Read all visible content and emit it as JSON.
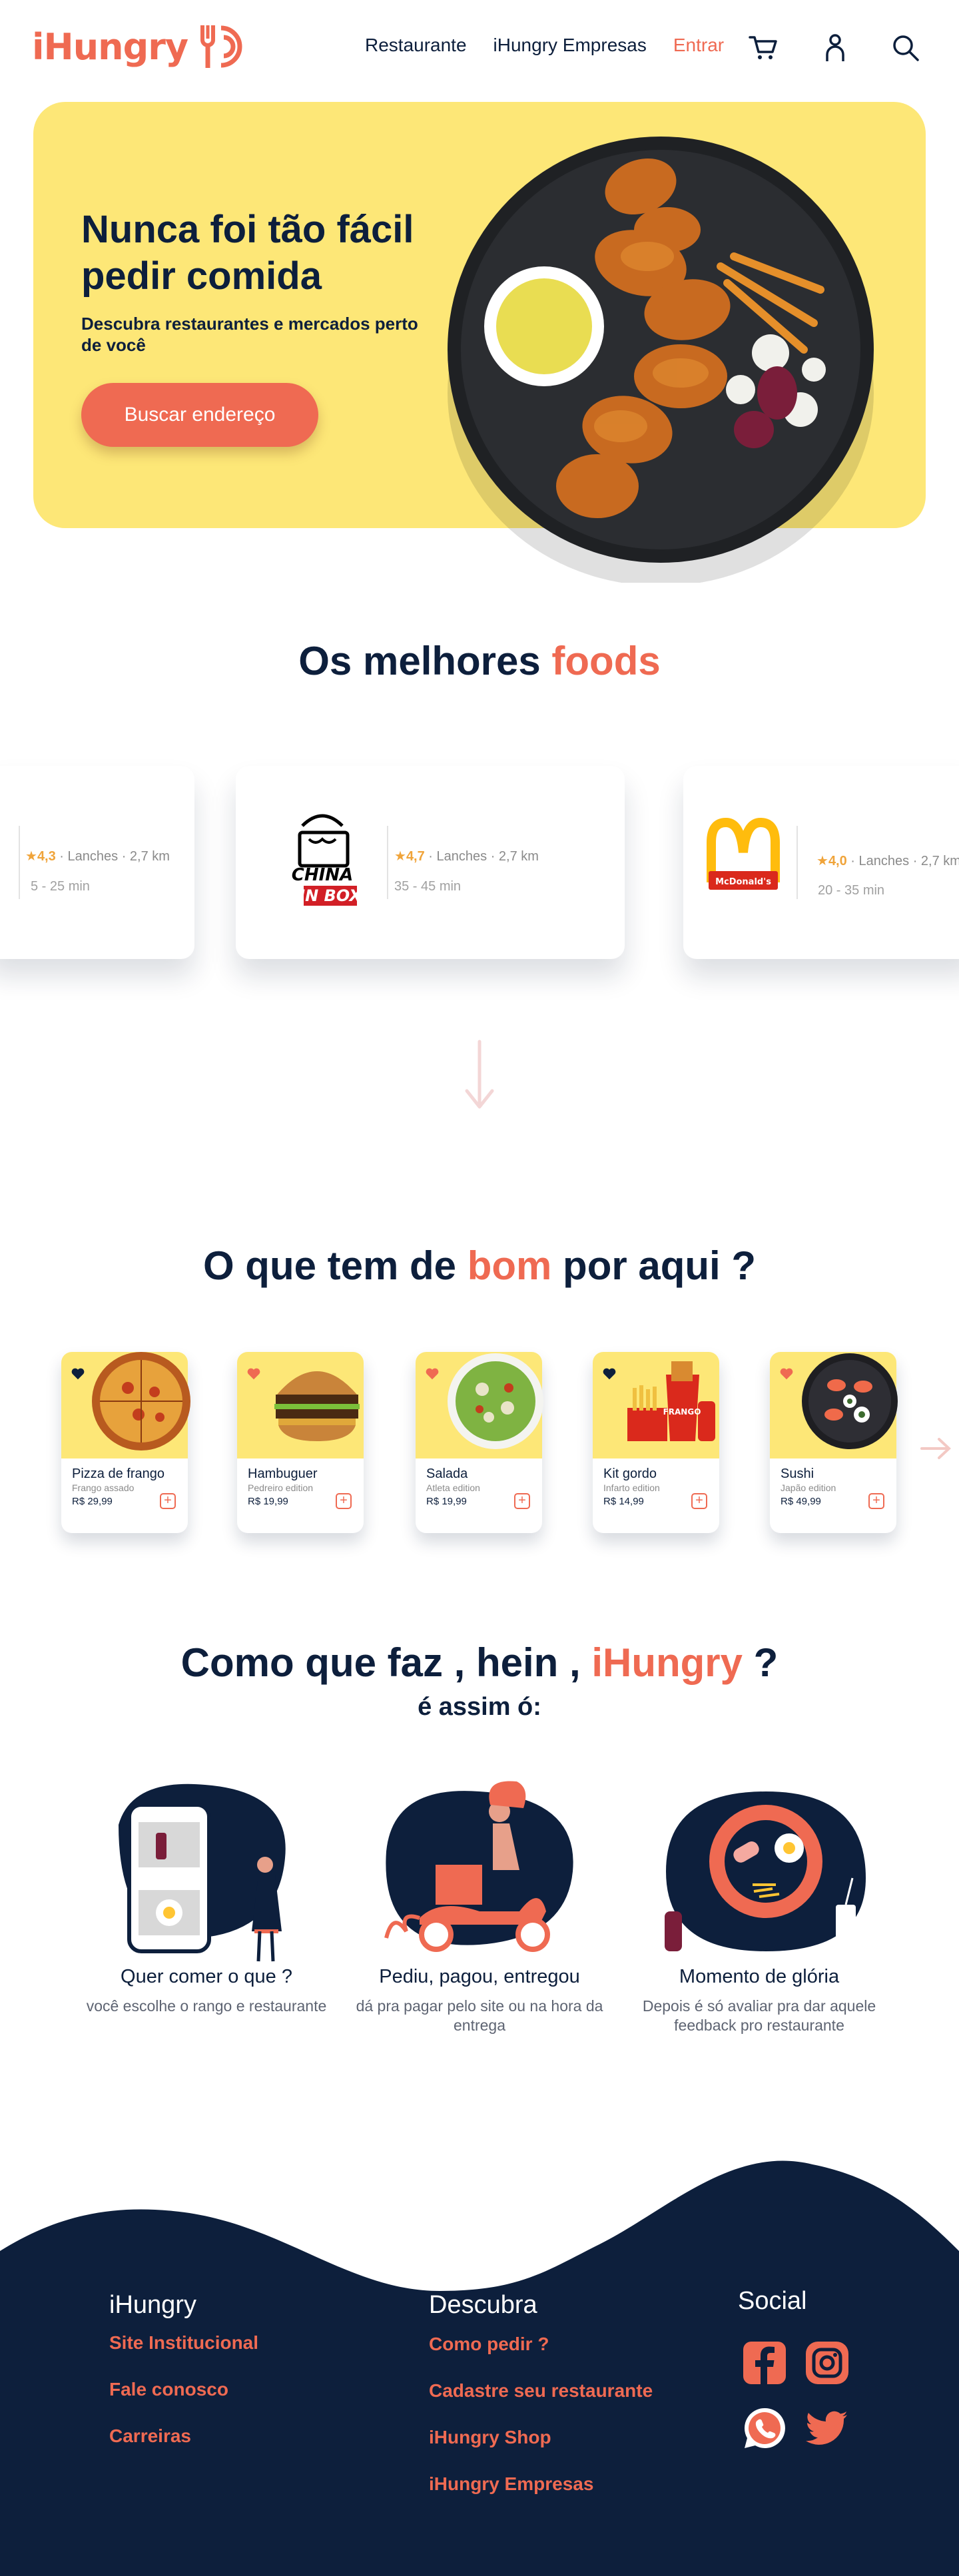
{
  "brand": {
    "name": "iHungry",
    "accent": "#ef6a52",
    "navy": "#0d1f3c",
    "yellow": "#fde777"
  },
  "nav": {
    "links": [
      "Restaurante",
      "iHungry Empresas",
      "Entrar"
    ],
    "icons": [
      "cart-icon",
      "user-icon",
      "search-icon"
    ]
  },
  "hero": {
    "title": "Nunca foi tão fácil pedir comida",
    "subtitle": "Descubra restaurantes e mercados perto de você",
    "button": "Buscar endereço"
  },
  "best": {
    "title_main": "Os melhores ",
    "title_accent": "foods",
    "restaurants": [
      {
        "rating": "4,3",
        "meta": " · Lanches · 2,7 km",
        "time": "5 - 25 min"
      },
      {
        "logo": "China In Box",
        "rating": "4,7",
        "meta": " · Lanches · 2,7 km",
        "time": "35 - 45 min"
      },
      {
        "logo": "McDonald's",
        "rating": "4,0",
        "meta": " · Lanches · 2,7 km",
        "time": "20 - 35 min"
      }
    ]
  },
  "menu": {
    "title_pre": "O que tem de ",
    "title_accent": "bom",
    "title_post": " por aqui ?",
    "items": [
      {
        "name": "Pizza de frango",
        "desc": "Frango assado",
        "price": "R$ 29,99",
        "liked": false
      },
      {
        "name": "Hambuguer",
        "desc": "Pedreiro edition",
        "price": "R$ 19,99",
        "liked": true
      },
      {
        "name": "Salada",
        "desc": "Atleta edition",
        "price": "R$ 19,99",
        "liked": true
      },
      {
        "name": "Kit gordo",
        "desc": "Infarto edition",
        "price": "R$ 14,99",
        "liked": false
      },
      {
        "name": "Sushi",
        "desc": "Japão edition",
        "price": "R$ 49,99",
        "liked": true
      }
    ]
  },
  "how": {
    "title_pre": "Como que faz , hein , ",
    "title_accent": "iHungry",
    "title_post": " ?",
    "subtitle": "é assim ó:",
    "steps": [
      {
        "title": "Quer comer o que ?",
        "desc": "você escolhe o rango e restaurante"
      },
      {
        "title": "Pediu,  pagou, entregou",
        "desc": "dá pra pagar pelo site ou na hora da entrega"
      },
      {
        "title": "Momento de glória",
        "desc": "Depois é só avaliar pra dar aquele feedback pro restaurante"
      }
    ]
  },
  "footer": {
    "col1": {
      "title": "iHungry",
      "links": [
        "Site Institucional",
        "Fale conosco",
        "Carreiras"
      ]
    },
    "col2": {
      "title": "Descubra",
      "links": [
        "Como pedir ?",
        "Cadastre seu restaurante",
        "iHungry Shop",
        "iHungry Empresas"
      ]
    },
    "col3": {
      "title": "Social",
      "icons": [
        "facebook-icon",
        "instagram-icon",
        "whatsapp-icon",
        "twitter-icon"
      ]
    }
  }
}
